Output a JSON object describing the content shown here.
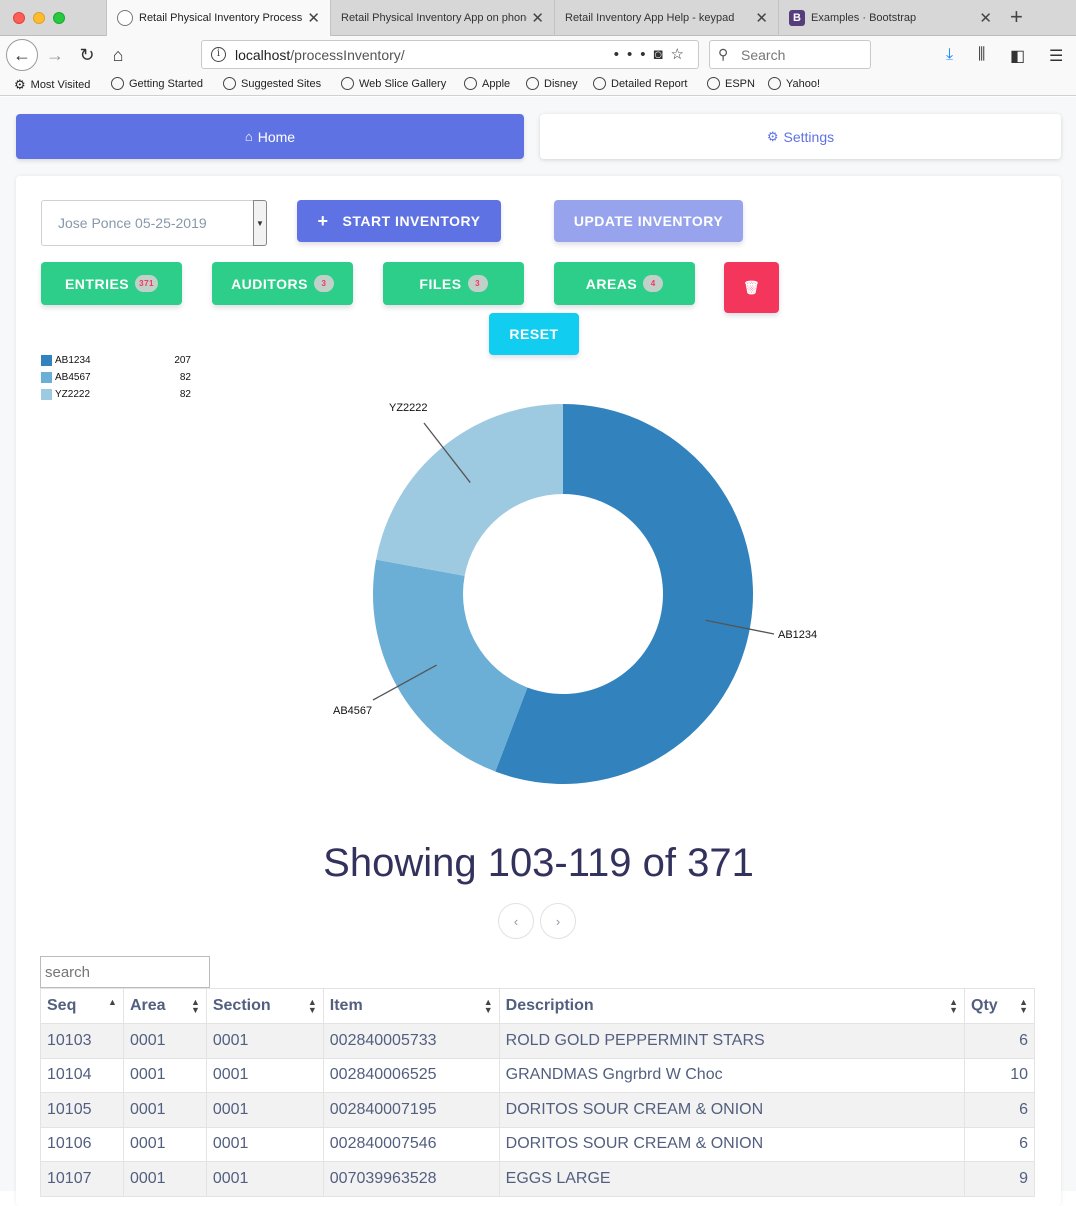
{
  "browser": {
    "tabs": [
      {
        "label": "Retail Physical Inventory Process",
        "active": true
      },
      {
        "label": "Retail Physical Inventory App on phone",
        "active": false
      },
      {
        "label": "Retail Inventory App Help - keypad",
        "active": false
      },
      {
        "label": "Examples · Bootstrap",
        "active": false
      }
    ],
    "url_host": "localhost",
    "url_path": "/processInventory/",
    "search_placeholder": "Search",
    "bookmarks": [
      "Most Visited",
      "Getting Started",
      "Suggested Sites",
      "Web Slice Gallery",
      "Apple",
      "Disney",
      "Detailed Report",
      "ESPN",
      "Yahoo!"
    ]
  },
  "nav": {
    "home_label": "Home",
    "settings_label": "Settings"
  },
  "controls": {
    "selected_inventory": "Jose Ponce 05-25-2019",
    "start_label": "START INVENTORY",
    "update_label": "UPDATE INVENTORY",
    "entries_label": "ENTRIES",
    "entries_count": "371",
    "auditors_label": "AUDITORS",
    "auditors_count": "3",
    "files_label": "FILES",
    "files_count": "3",
    "areas_label": "AREAS",
    "areas_count": "4",
    "reset_label": "RESET"
  },
  "chart_data": {
    "type": "pie",
    "categories": [
      "AB1234",
      "AB4567",
      "YZ2222"
    ],
    "values": [
      207,
      82,
      82
    ],
    "colors": [
      "#3182bd",
      "#6baed6",
      "#9ecae1"
    ],
    "donut": true,
    "legend": "top-left"
  },
  "pagination": {
    "showing_text": "Showing 103-119 of 371",
    "prev_symbol": "‹",
    "next_symbol": "›"
  },
  "table": {
    "search_placeholder": "search",
    "columns": [
      "Seq",
      "Area",
      "Section",
      "Item",
      "Description",
      "Qty"
    ],
    "rows": [
      [
        "10103",
        "0001",
        "0001",
        "002840005733",
        "ROLD GOLD PEPPERMINT STARS",
        "6"
      ],
      [
        "10104",
        "0001",
        "0001",
        "002840006525",
        "GRANDMAS Gngrbrd W Choc",
        "10"
      ],
      [
        "10105",
        "0001",
        "0001",
        "002840007195",
        "DORITOS SOUR CREAM & ONION",
        "6"
      ],
      [
        "10106",
        "0001",
        "0001",
        "002840007546",
        "DORITOS SOUR CREAM & ONION",
        "6"
      ],
      [
        "10107",
        "0001",
        "0001",
        "007039963528",
        "EGGS LARGE",
        "9"
      ]
    ]
  }
}
